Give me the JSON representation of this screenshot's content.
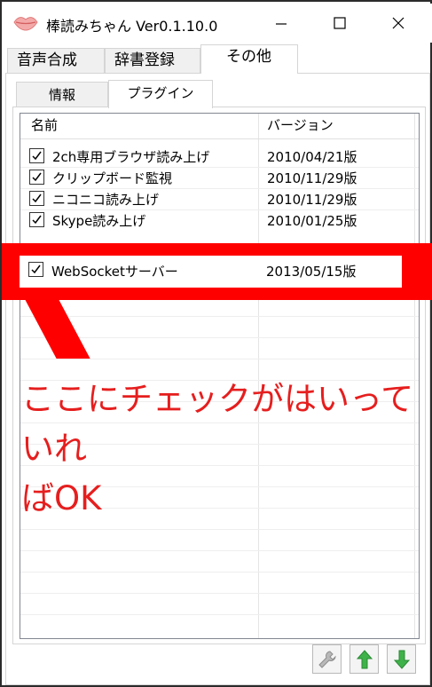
{
  "window": {
    "title": "棒読みちゃん Ver0.1.10.0",
    "controls": {
      "minimize": "—",
      "maximize": "☐",
      "close": "✕"
    }
  },
  "outer_tabs": [
    "音声合成",
    "辞書登録",
    "その他"
  ],
  "inner_tabs": [
    "情報",
    "プラグイン"
  ],
  "plugin_list": {
    "columns": [
      "名前",
      "バージョン"
    ],
    "rows": [
      {
        "name": "2ch専用ブラウザ読み上げ",
        "version": "2010/04/21版",
        "checked": true
      },
      {
        "name": "クリップボード監視",
        "version": "2010/11/29版",
        "checked": true
      },
      {
        "name": "ニコニコ読み上げ",
        "version": "2010/11/29版",
        "checked": true
      },
      {
        "name": "Skype読み上げ",
        "version": "2010/01/25版",
        "checked": true
      }
    ],
    "highlighted_row": {
      "name": "WebSocketサーバー",
      "version": "2013/05/15版",
      "checked": true
    }
  },
  "annotation": {
    "line1": "ここにチェックがはいっていれ",
    "line2": "ばOK"
  },
  "colors": {
    "highlight": "#ff0000",
    "annotation_text": "#e61e1e",
    "up_arrow": "#3fb24a",
    "down_arrow": "#3fb24a",
    "wrench": "#9a9a9a"
  },
  "icons": {
    "app": "lips-icon",
    "settings": "wrench-icon",
    "move_up": "arrow-up-icon",
    "move_down": "arrow-down-icon"
  }
}
